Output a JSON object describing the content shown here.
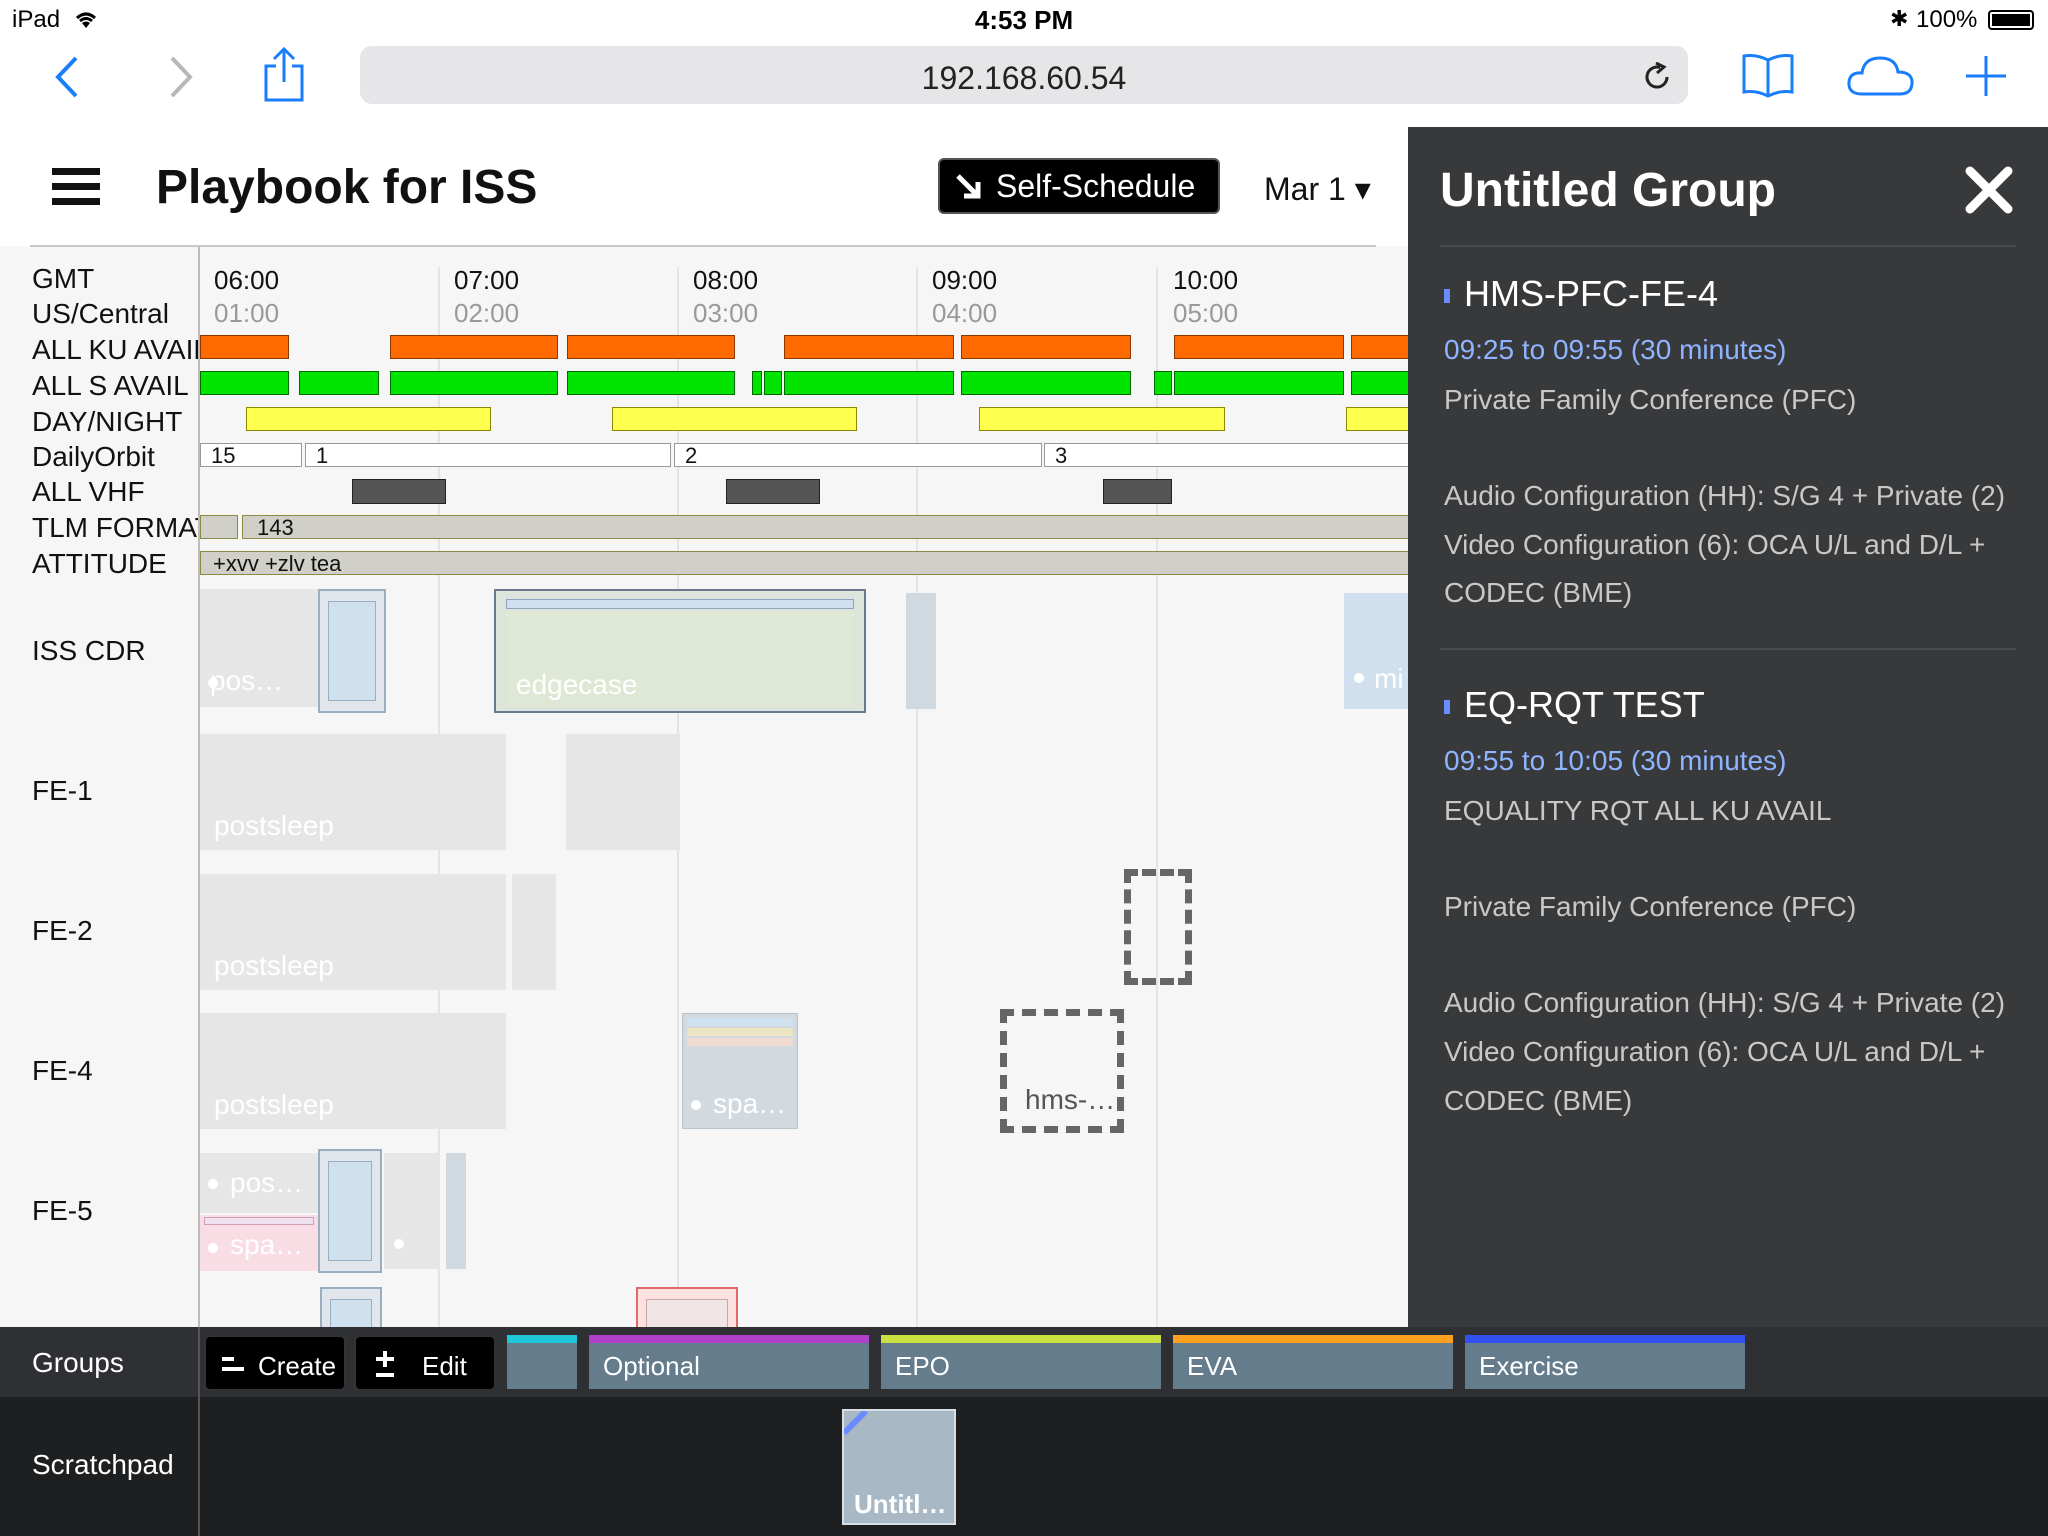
{
  "status_bar": {
    "device": "iPad",
    "time": "4:53 PM",
    "battery": "100%"
  },
  "browser": {
    "url": "192.168.60.54"
  },
  "header": {
    "title": "Playbook for ISS",
    "self_schedule_label": "Self-Schedule",
    "date_label": "Mar 1 ▾"
  },
  "timeline": {
    "gmt_label": "GMT",
    "local_label": "US/Central",
    "hours_gmt": [
      "06:00",
      "07:00",
      "08:00",
      "09:00",
      "10:00"
    ],
    "hours_local": [
      "01:00",
      "02:00",
      "03:00",
      "04:00",
      "05:00"
    ],
    "row_labels": {
      "ku": "ALL KU AVAIL",
      "s": "ALL S AVAIL",
      "daynight": "DAY/NIGHT",
      "orbit": "DailyOrbit",
      "vhf": "ALL VHF",
      "tlm": "TLM FORMAT",
      "attitude": "ATTITUDE",
      "cdr": "ISS CDR",
      "fe1": "FE-1",
      "fe2": "FE-2",
      "fe4": "FE-4",
      "fe5": "FE-5"
    },
    "orbit_numbers": [
      "15",
      "1",
      "2",
      "3"
    ],
    "tlm_value": "143",
    "attitude_value": "+xvv +zlv tea",
    "blocks": {
      "cdr_pos": "pos…",
      "cdr_edgecase": "edgecase",
      "cdr_right": "mi",
      "fe1_postsleep": "postsleep",
      "fe2_postsleep": "postsleep",
      "fe4_postsleep": "postsleep",
      "fe4_spa": "spa…",
      "fe4_hms": "hms-…",
      "fe5_pos": "pos…",
      "fe5_spa": "spa…"
    }
  },
  "panel": {
    "title": "Untitled Group",
    "items": [
      {
        "name": "HMS-PFC-FE-4",
        "time": "09:25 to 09:55 (30 minutes)",
        "lines": [
          "Private Family Conference (PFC)",
          "",
          "Audio Configuration (HH): S/G 4 + Private (2)",
          "Video Configuration (6): OCA U/L and D/L +",
          "CODEC (BME)"
        ]
      },
      {
        "name": "EQ-RQT TEST",
        "time": "09:55 to 10:05 (30 minutes)",
        "lines": [
          "EQUALITY RQT ALL KU AVAIL",
          "",
          "Private Family Conference (PFC)",
          "",
          "Audio Configuration (HH): S/G 4 + Private (2)",
          "Video Configuration (6): OCA U/L and D/L +",
          "CODEC (BME)"
        ]
      }
    ]
  },
  "groups": {
    "label": "Groups",
    "create_label": "Create",
    "edit_label": "Edit",
    "tabs": [
      {
        "label": "",
        "color": "#1ec8d8"
      },
      {
        "label": "Optional",
        "color": "#b040c8"
      },
      {
        "label": "EPO",
        "color": "#c8e040"
      },
      {
        "label": "EVA",
        "color": "#ffa020"
      },
      {
        "label": "Exercise",
        "color": "#3050f0"
      }
    ]
  },
  "scratchpad": {
    "label": "Scratchpad",
    "item_label": "Untitl…"
  }
}
